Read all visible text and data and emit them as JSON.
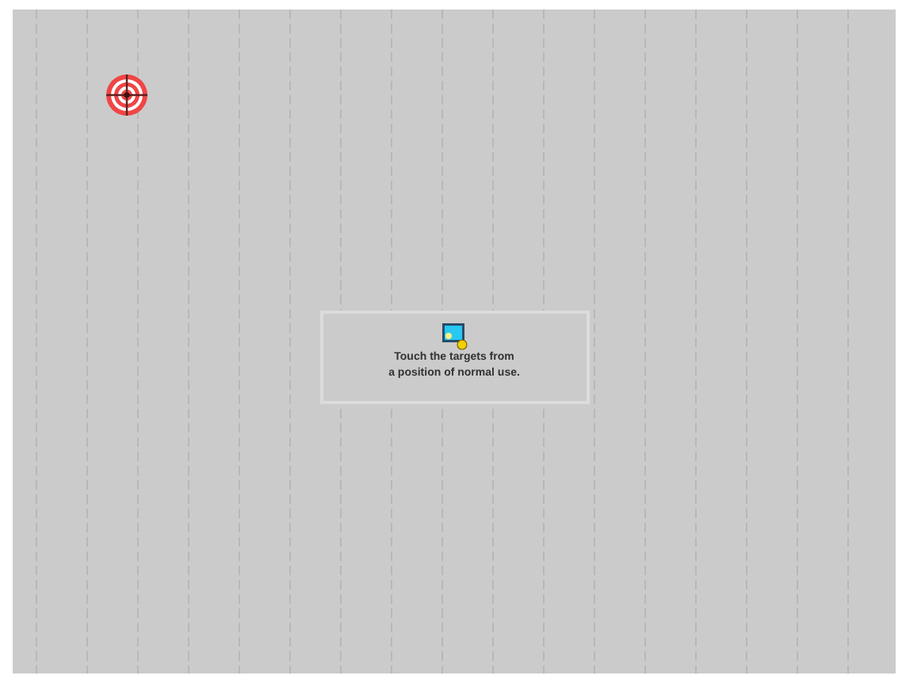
{
  "calibration": {
    "message": [
      "Touch the targets from",
      "a position of normal use."
    ]
  }
}
